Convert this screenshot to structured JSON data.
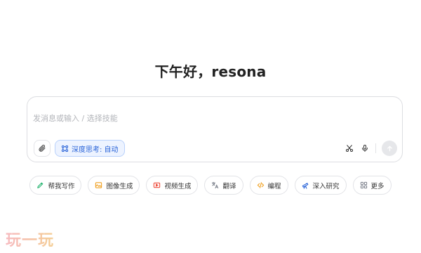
{
  "greeting": "下午好，resona",
  "composer": {
    "placeholder": "发消息或输入 / 选择技能",
    "deep_think_label": "深度思考: 自动"
  },
  "skills": [
    {
      "label": "帮我写作",
      "icon": "pen-icon",
      "color": "#2bb673"
    },
    {
      "label": "图像生成",
      "icon": "image-icon",
      "color": "#f0a020"
    },
    {
      "label": "视频生成",
      "icon": "video-icon",
      "color": "#ee4d3d"
    },
    {
      "label": "翻译",
      "icon": "translate-icon",
      "color": "#7a7f8a"
    },
    {
      "label": "编程",
      "icon": "code-icon",
      "color": "#f0a020"
    },
    {
      "label": "深入研究",
      "icon": "telescope-icon",
      "color": "#2a64d8"
    },
    {
      "label": "更多",
      "icon": "grid-icon",
      "color": "#7a7f8a"
    }
  ],
  "watermark": "玩一玩",
  "colors": {
    "accent": "#2a64d8",
    "accent_bg": "#edf3ff",
    "border": "#dcdde1"
  }
}
